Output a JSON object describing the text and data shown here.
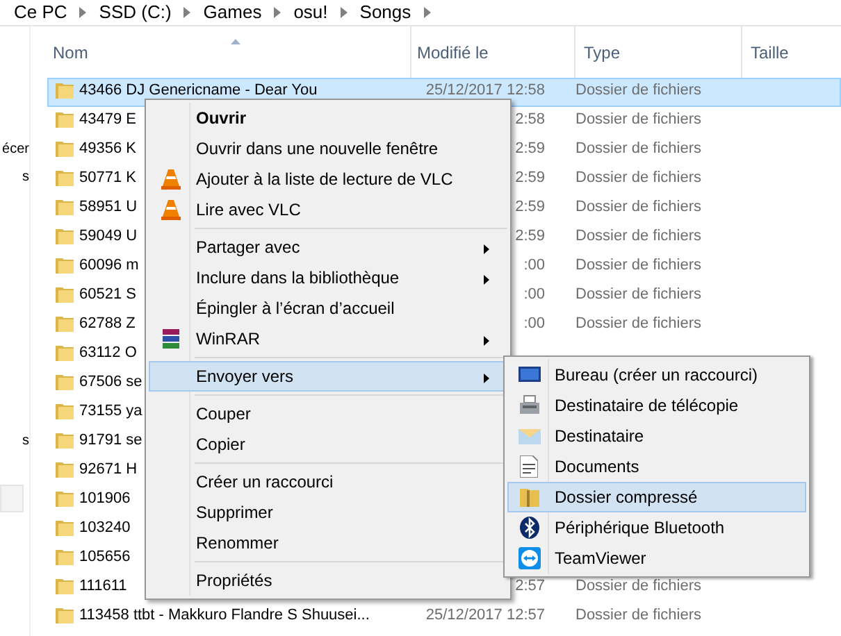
{
  "breadcrumb": [
    "Ce PC",
    "SSD (C:)",
    "Games",
    "osu!",
    "Songs"
  ],
  "nav_pane": {
    "items": [
      {
        "label": "écer"
      },
      {
        "label": "s"
      },
      {
        "label": "s"
      }
    ]
  },
  "columns": [
    {
      "label": "Nom",
      "sorted": true
    },
    {
      "label": "Modifié le",
      "sorted": false
    },
    {
      "label": "Type",
      "sorted": false
    },
    {
      "label": "Taille",
      "sorted": false
    }
  ],
  "rows": [
    {
      "name": "43466 DJ Genericname - Dear You",
      "modified": "25/12/2017 12:58",
      "type": "Dossier de fichiers",
      "selected": true
    },
    {
      "name": "43479 E",
      "modified": "2:58",
      "type": "Dossier de fichiers",
      "selected": false
    },
    {
      "name": "49356 K",
      "modified": "2:59",
      "type": "Dossier de fichiers",
      "selected": false
    },
    {
      "name": "50771 K",
      "modified": "2:59",
      "type": "Dossier de fichiers",
      "selected": false
    },
    {
      "name": "58951 U",
      "modified": "2:59",
      "type": "Dossier de fichiers",
      "selected": false
    },
    {
      "name": "59049 U",
      "modified": "2:59",
      "type": "Dossier de fichiers",
      "selected": false
    },
    {
      "name": "60096 m",
      "modified": ":00",
      "type": "Dossier de fichiers",
      "selected": false
    },
    {
      "name": "60521 S",
      "modified": ":00",
      "type": "Dossier de fichiers",
      "selected": false
    },
    {
      "name": "62788 Z",
      "modified": ":00",
      "type": "Dossier de fichiers",
      "selected": false
    },
    {
      "name": "63112 O",
      "selected": false
    },
    {
      "name": "67506 se",
      "selected": false
    },
    {
      "name": "73155 ya",
      "selected": false
    },
    {
      "name": "91791 se",
      "selected": false
    },
    {
      "name": "92671 H",
      "selected": false
    },
    {
      "name": "101906",
      "selected": false
    },
    {
      "name": "103240",
      "selected": false
    },
    {
      "name": "105656",
      "selected": false
    },
    {
      "name": "111611",
      "modified": "2:57",
      "type": "Dossier de fichiers",
      "selected": false
    },
    {
      "name": "113458 ttbt - Makkuro Flandre S Shuusei...",
      "modified": "25/12/2017 12:57",
      "type": "Dossier de fichiers",
      "selected": false
    }
  ],
  "context_menu": {
    "items": [
      {
        "kind": "item",
        "label": "Ouvrir",
        "bold": true,
        "submenu": false,
        "selected": false
      },
      {
        "kind": "item",
        "label": "Ouvrir dans une nouvelle fenêtre",
        "bold": false,
        "submenu": false,
        "selected": false
      },
      {
        "kind": "item",
        "label": "Ajouter à la liste de lecture de VLC",
        "bold": false,
        "submenu": false,
        "selected": false
      },
      {
        "kind": "item",
        "label": "Lire avec VLC",
        "bold": false,
        "submenu": false,
        "selected": false
      },
      {
        "kind": "separator"
      },
      {
        "kind": "item",
        "label": "Partager avec",
        "bold": false,
        "submenu": true,
        "selected": false
      },
      {
        "kind": "item",
        "label": "Inclure dans la bibliothèque",
        "bold": false,
        "submenu": true,
        "selected": false
      },
      {
        "kind": "item",
        "label": "Épingler à l’écran d’accueil",
        "bold": false,
        "submenu": false,
        "selected": false
      },
      {
        "kind": "item",
        "label": "WinRAR",
        "bold": false,
        "submenu": true,
        "selected": false
      },
      {
        "kind": "separator"
      },
      {
        "kind": "item",
        "label": "Envoyer vers",
        "bold": false,
        "submenu": true,
        "selected": true
      },
      {
        "kind": "separator"
      },
      {
        "kind": "item",
        "label": "Couper",
        "bold": false,
        "submenu": false,
        "selected": false
      },
      {
        "kind": "item",
        "label": "Copier",
        "bold": false,
        "submenu": false,
        "selected": false
      },
      {
        "kind": "separator"
      },
      {
        "kind": "item",
        "label": "Créer un raccourci",
        "bold": false,
        "submenu": false,
        "selected": false
      },
      {
        "kind": "item",
        "label": "Supprimer",
        "bold": false,
        "submenu": false,
        "selected": false
      },
      {
        "kind": "item",
        "label": "Renommer",
        "bold": false,
        "submenu": false,
        "selected": false
      },
      {
        "kind": "separator"
      },
      {
        "kind": "item",
        "label": "Propriétés",
        "bold": false,
        "submenu": false,
        "selected": false
      }
    ]
  },
  "send_to_menu": {
    "items": [
      {
        "label": "Bureau (créer un raccourci)",
        "selected": false
      },
      {
        "label": "Destinataire de télécopie",
        "selected": false
      },
      {
        "label": "Destinataire",
        "selected": false
      },
      {
        "label": "Documents",
        "selected": false
      },
      {
        "label": "Dossier compressé",
        "selected": true
      },
      {
        "label": "Périphérique Bluetooth",
        "selected": false
      },
      {
        "label": "TeamViewer",
        "selected": false
      }
    ]
  }
}
